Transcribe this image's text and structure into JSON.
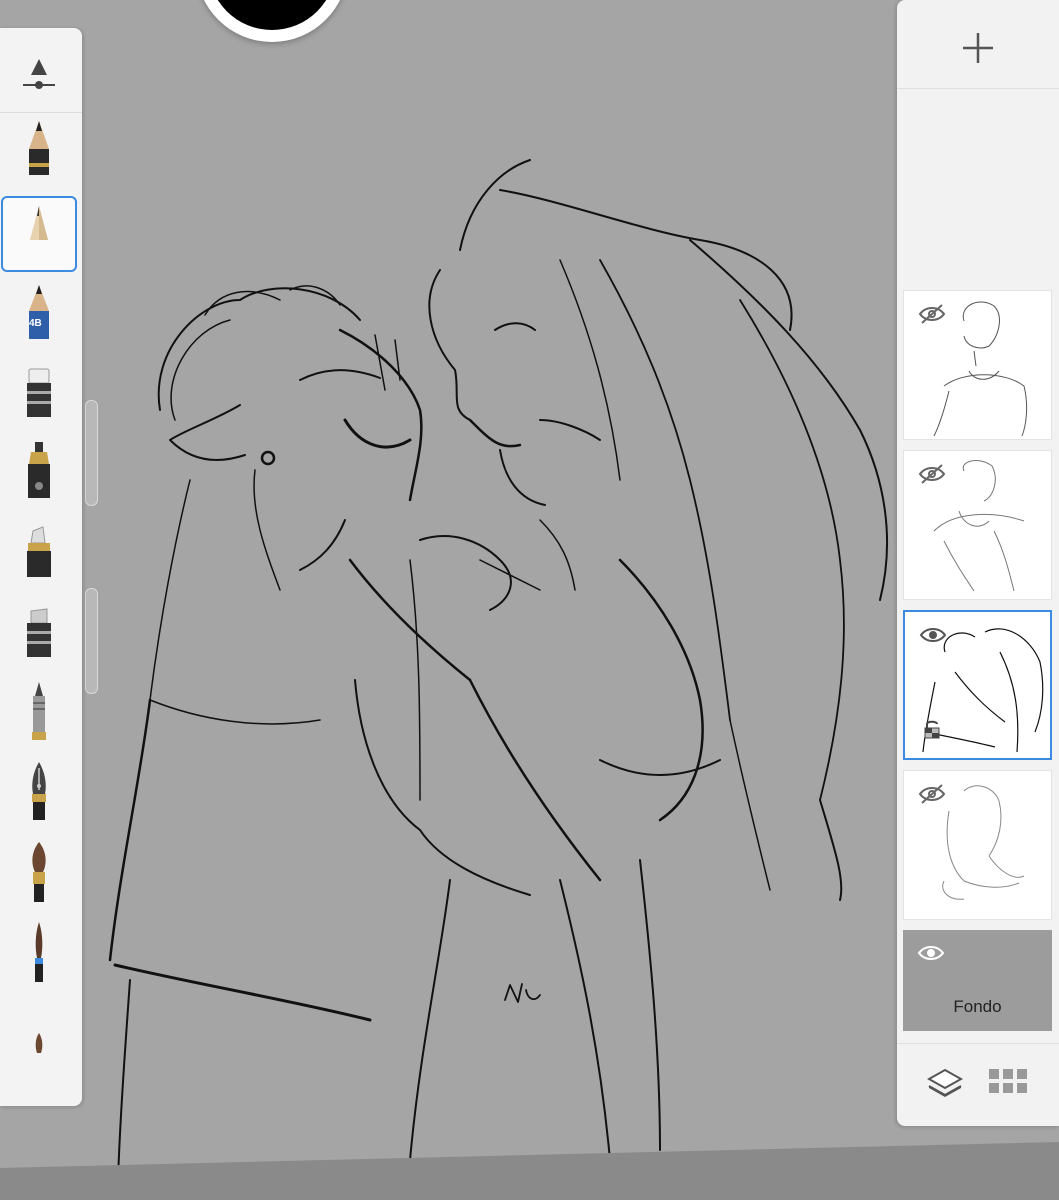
{
  "app": {
    "accent_color": "#3c8be0",
    "canvas_color": "#a5a5a5",
    "current_brush_color": "#000000"
  },
  "toolbar": {
    "tools": [
      {
        "name": "brush-properties-icon"
      },
      {
        "name": "pencil-icon"
      },
      {
        "name": "hard-pencil-icon",
        "selected": true
      },
      {
        "name": "pencil-4b-icon",
        "label": "4B"
      },
      {
        "name": "eraser-icon"
      },
      {
        "name": "airbrush-icon"
      },
      {
        "name": "marker-icon"
      },
      {
        "name": "chisel-marker-icon"
      },
      {
        "name": "ballpoint-pen-icon"
      },
      {
        "name": "fountain-pen-icon"
      },
      {
        "name": "paint-brush-icon"
      },
      {
        "name": "fine-brush-icon"
      },
      {
        "name": "brush-partial-icon"
      }
    ]
  },
  "layers": {
    "add_icon": "plus-icon",
    "items": [
      {
        "visible": false,
        "selected": false
      },
      {
        "visible": false,
        "selected": false
      },
      {
        "visible": true,
        "selected": true,
        "locked": true
      },
      {
        "visible": false,
        "selected": false
      }
    ],
    "background": {
      "label": "Fondo",
      "visible": true
    },
    "footer": [
      {
        "icon": "layers-stack-icon"
      },
      {
        "icon": "grid-icon"
      }
    ]
  },
  "canvas": {
    "signature": "NU"
  }
}
